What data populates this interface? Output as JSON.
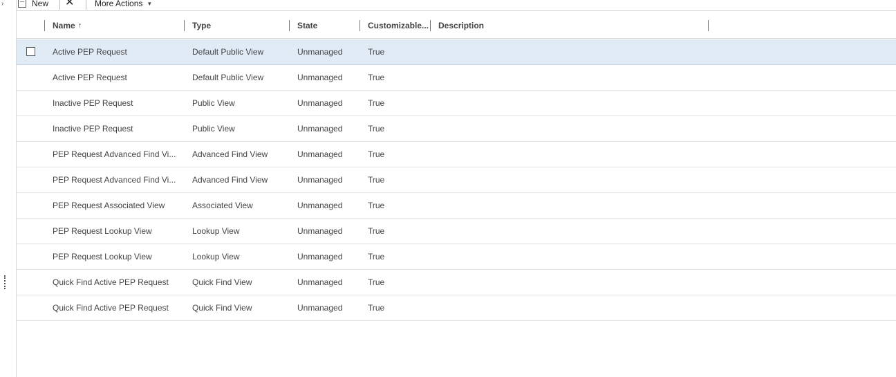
{
  "toolbar": {
    "new_label": "New",
    "delete_icon": "✕",
    "more_actions_label": "More Actions",
    "more_caret": "▼"
  },
  "left_pane": {
    "edge_mark": "›"
  },
  "grid": {
    "columns": {
      "name": "Name",
      "name_sort": "↑",
      "type": "Type",
      "state": "State",
      "customizable": "Customizable...",
      "description": "Description"
    },
    "rows": [
      {
        "name": "Active PEP Request",
        "type": "Default Public View",
        "state": "Unmanaged",
        "customizable": "True",
        "description": ""
      },
      {
        "name": "Active PEP Request",
        "type": "Default Public View",
        "state": "Unmanaged",
        "customizable": "True",
        "description": ""
      },
      {
        "name": "Inactive PEP Request",
        "type": "Public View",
        "state": "Unmanaged",
        "customizable": "True",
        "description": ""
      },
      {
        "name": "Inactive PEP Request",
        "type": "Public View",
        "state": "Unmanaged",
        "customizable": "True",
        "description": ""
      },
      {
        "name": "PEP Request Advanced Find Vi...",
        "type": "Advanced Find View",
        "state": "Unmanaged",
        "customizable": "True",
        "description": ""
      },
      {
        "name": "PEP Request Advanced Find Vi...",
        "type": "Advanced Find View",
        "state": "Unmanaged",
        "customizable": "True",
        "description": ""
      },
      {
        "name": "PEP Request Associated View",
        "type": "Associated View",
        "state": "Unmanaged",
        "customizable": "True",
        "description": ""
      },
      {
        "name": "PEP Request Lookup View",
        "type": "Lookup View",
        "state": "Unmanaged",
        "customizable": "True",
        "description": ""
      },
      {
        "name": "PEP Request Lookup View",
        "type": "Lookup View",
        "state": "Unmanaged",
        "customizable": "True",
        "description": ""
      },
      {
        "name": "Quick Find Active PEP Request",
        "type": "Quick Find View",
        "state": "Unmanaged",
        "customizable": "True",
        "description": ""
      },
      {
        "name": "Quick Find Active PEP Request",
        "type": "Quick Find View",
        "state": "Unmanaged",
        "customizable": "True",
        "description": ""
      }
    ]
  }
}
